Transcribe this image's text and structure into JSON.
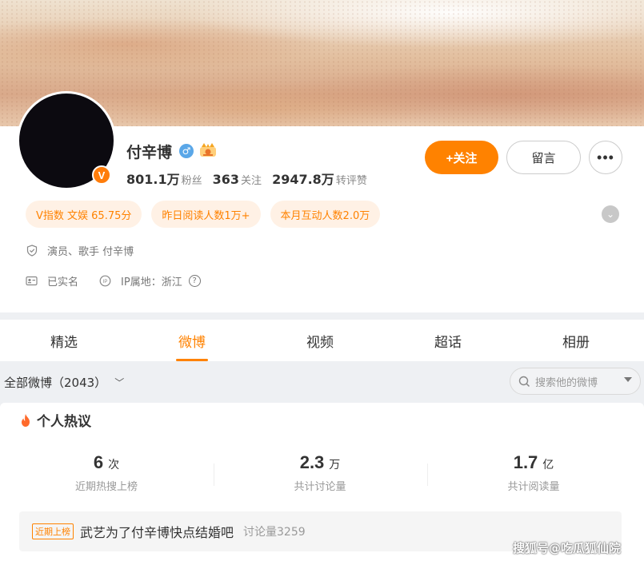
{
  "profile": {
    "name": "付辛博",
    "avatar_badge": "V",
    "stats": [
      {
        "num": "801.1万",
        "label": "粉丝"
      },
      {
        "num": "363",
        "label": "关注"
      },
      {
        "num": "2947.8万",
        "label": "转评赞"
      }
    ],
    "follow_label": "+关注",
    "message_label": "留言",
    "more_label": "•••",
    "tags": [
      "V指数 文娱 65.75分",
      "昨日阅读人数1万+",
      "本月互动人数2.0万"
    ],
    "description": "演员、歌手 付辛博",
    "verified_label": "已实名",
    "ip_label": "IP属地：浙江"
  },
  "tabs": [
    {
      "label": "精选"
    },
    {
      "label": "微博"
    },
    {
      "label": "视频"
    },
    {
      "label": "超话"
    },
    {
      "label": "相册"
    }
  ],
  "active_tab": "微博",
  "filter": {
    "label": "全部微博（2043）",
    "search_placeholder": "搜索他的微博"
  },
  "hot": {
    "title": "个人热议",
    "metrics": [
      {
        "value": "6",
        "unit": "次",
        "label": "近期热搜上榜"
      },
      {
        "value": "2.3",
        "unit": "万",
        "label": "共计讨论量"
      },
      {
        "value": "1.7",
        "unit": "亿",
        "label": "共计阅读量"
      }
    ],
    "topic": {
      "badge": "近期上榜",
      "text": "武艺为了付辛博快点结婚吧",
      "count": "讨论量3259"
    }
  },
  "watermark": "搜狐号@吃瓜狐仙院",
  "colors": {
    "accent": "#ff8200",
    "tag_bg": "#fff1e5",
    "male": "#5aa7e8"
  }
}
